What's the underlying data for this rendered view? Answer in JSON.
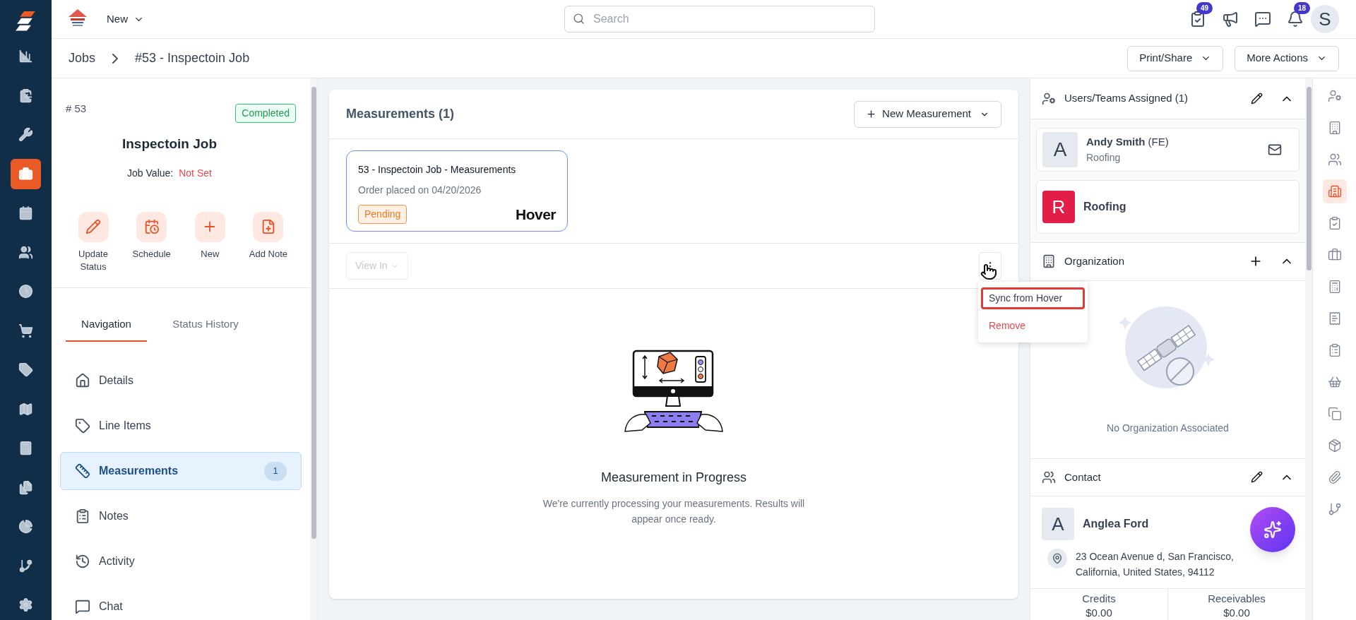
{
  "rail": [
    {
      "selected": false
    },
    {
      "selected": false
    },
    {
      "selected": false
    },
    {
      "selected": true
    },
    {
      "selected": false
    },
    {
      "selected": false
    },
    {
      "selected": false
    },
    {
      "selected": false
    },
    {
      "selected": false
    },
    {
      "selected": false
    },
    {
      "selected": false
    },
    {
      "selected": false
    },
    {
      "selected": false
    },
    {
      "selected": false
    },
    {
      "selected": false
    }
  ],
  "topbar": {
    "new_menu": "New",
    "search": {
      "placeholder": "Search"
    },
    "tasks_badge": "49",
    "notifications_badge": "18",
    "avatar": "S"
  },
  "breadcrumb": [
    "Jobs",
    "#53 - Inspectoin Job"
  ],
  "header_actions": [
    "Print/Share",
    "More Actions"
  ],
  "job": {
    "number": "# 53",
    "status": "Completed",
    "title": "Inspectoin Job",
    "value_label": "Job Value:",
    "value": "Not Set"
  },
  "quick_actions": [
    {
      "label": "Update Status"
    },
    {
      "label": "Schedule"
    },
    {
      "label": "New"
    },
    {
      "label": "Add Note"
    }
  ],
  "tabs": [
    {
      "label": "Navigation",
      "selected": true
    },
    {
      "label": "Status History",
      "selected": false
    }
  ],
  "nav": [
    {
      "label": "Details",
      "selected": false
    },
    {
      "label": "Line Items",
      "selected": false
    },
    {
      "label": "Measurements",
      "selected": true,
      "count": "1"
    },
    {
      "label": "Notes",
      "selected": false
    },
    {
      "label": "Activity",
      "selected": false
    },
    {
      "label": "Chat",
      "selected": false
    }
  ],
  "measurements": {
    "title": "Measurements (1)",
    "new_button": "New Measurement",
    "cards": [
      {
        "title": "53 - Inspectoin Job - Measurements",
        "subtitle": "Order placed on 04/20/2026",
        "status": "Pending",
        "provider": "Hover"
      }
    ],
    "view_in": {
      "label": "View In",
      "disabled": true
    },
    "menu": [
      {
        "label": "Sync from Hover",
        "kind": "normal",
        "highlighted": true
      },
      {
        "label": "Remove",
        "kind": "danger",
        "highlighted": false
      }
    ],
    "empty": {
      "title": "Measurement in Progress",
      "text": "We're currently processing your measurements. Results will appear once ready."
    }
  },
  "users": {
    "title": "Users/Teams Assigned (1)",
    "members": [
      {
        "kind": "user",
        "initial": "A",
        "name": "Andy Smith",
        "tag": "(FE)",
        "team": "Roofing"
      },
      {
        "kind": "team",
        "initial": "R",
        "name": "Roofing"
      }
    ]
  },
  "organization": {
    "title": "Organization",
    "empty": "No Organization Associated"
  },
  "contact": {
    "title": "Contact",
    "initial": "A",
    "name": "Anglea Ford",
    "address": "23 Ocean Avenue d, San Francisco, California, United States, 94112"
  },
  "balances": [
    {
      "label": "Credits",
      "value": "$0.00"
    },
    {
      "label": "Receivables",
      "value": "$0.00"
    }
  ],
  "right_rail": [
    {
      "selected": false
    },
    {
      "selected": false
    },
    {
      "selected": false
    },
    {
      "selected": true
    },
    {
      "selected": false
    },
    {
      "selected": false
    },
    {
      "selected": false
    },
    {
      "selected": false
    },
    {
      "selected": false
    },
    {
      "selected": false
    },
    {
      "selected": false
    },
    {
      "selected": false
    },
    {
      "selected": false
    },
    {
      "selected": false
    }
  ]
}
